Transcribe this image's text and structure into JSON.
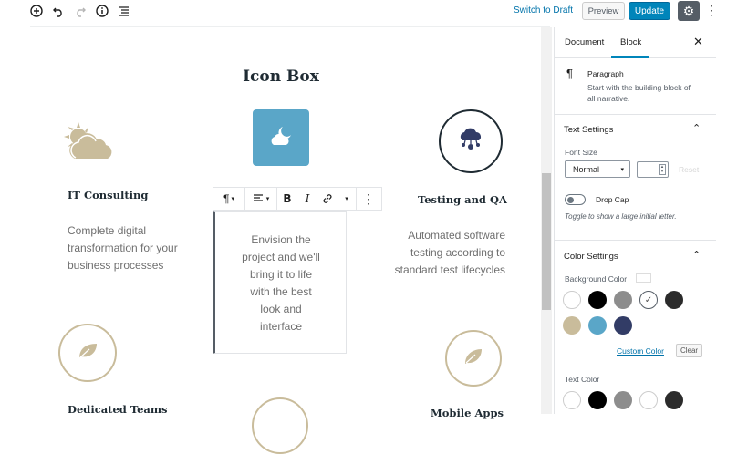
{
  "toolbar": {
    "switch_to_draft": "Switch to Draft",
    "preview": "Preview",
    "update": "Update",
    "icons": [
      "add-block-icon",
      "undo-icon",
      "redo-icon",
      "info-icon",
      "list-view-icon",
      "gear-icon",
      "more-vertical-icon"
    ]
  },
  "content": {
    "title": "Icon Box",
    "boxes": [
      {
        "heading": "IT Consulting",
        "text_lines": [
          "Complete digital",
          "transformation for your",
          "business processes"
        ],
        "icon": "sun-cloud-icon"
      },
      {
        "text_lines": [
          "Envision the",
          "project and we'll",
          "bring it to life",
          "with the best",
          "look and",
          "interface"
        ],
        "icon": "moon-cloud-icon"
      },
      {
        "heading": "Testing and QA",
        "text_lines": [
          "Automated software",
          "testing according to",
          "standard test lifecycles"
        ],
        "icon": "cloud-network-icon"
      },
      {
        "heading": "Dedicated Teams",
        "icon": "leaf-icon"
      },
      {
        "heading": "Mobile Apps",
        "icon": "leaf-icon"
      }
    ]
  },
  "block_toolbar": {
    "items": [
      "paragraph-icon",
      "align-icon",
      "bold-icon",
      "italic-icon",
      "link-icon",
      "more-rich-text-icon",
      "more-options-icon"
    ]
  },
  "sidebar": {
    "tabs": [
      "Document",
      "Block"
    ],
    "active_tab": "Block",
    "block_name": "Paragraph",
    "block_desc_1": "Start with the building block of",
    "block_desc_2": "all narrative.",
    "text_settings": "Text Settings",
    "font_size_label": "Font Size",
    "font_size_value": "Normal",
    "reset": "Reset",
    "drop_cap": "Drop Cap",
    "drop_cap_help": "Toggle to show a large initial letter.",
    "color_settings": "Color Settings",
    "background_color": "Background Color",
    "custom_color": "Custom Color",
    "clear": "Clear",
    "text_color": "Text Color",
    "colors": {
      "accent": "#0085ba",
      "swatches_row1": [
        "#ffffff",
        "#000000",
        "#8d8d8d",
        "#ffffff",
        "#2b2b2b"
      ],
      "swatches_row2": [
        "#c9bc9b",
        "#5aa6c8",
        "#323c66"
      ],
      "text_swatches": [
        "#ffffff",
        "#000000",
        "#8d8d8d",
        "#ffffff",
        "#2b2b2b"
      ]
    }
  }
}
